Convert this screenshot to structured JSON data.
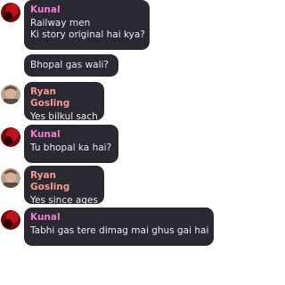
{
  "colors": {
    "bubble_bg": "#2a2830",
    "text": "#ececf0",
    "kunal_name": "#f07fd4",
    "ryan_name": "#f59a8a"
  },
  "messages": [
    {
      "sender": "Kunal",
      "avatar": "kunal-avatar",
      "lines": [
        "Railway men",
        "Ki story original hai kya?"
      ]
    },
    {
      "sender": "",
      "avatar": "",
      "lines": [
        "Bhopal gas wali?"
      ]
    },
    {
      "sender": "Ryan Gosling",
      "avatar": "ryan-avatar",
      "lines": [
        "Yes bilkul sach"
      ]
    },
    {
      "sender": "Kunal",
      "avatar": "kunal-avatar",
      "lines": [
        "Tu bhopal ka hai?"
      ]
    },
    {
      "sender": "Ryan Gosling",
      "avatar": "ryan-avatar",
      "lines": [
        "Yes since ages"
      ]
    },
    {
      "sender": "Kunal",
      "avatar": "kunal-avatar",
      "lines": [
        "Tabhi gas tere dimag mai ghus gai hai"
      ]
    }
  ]
}
